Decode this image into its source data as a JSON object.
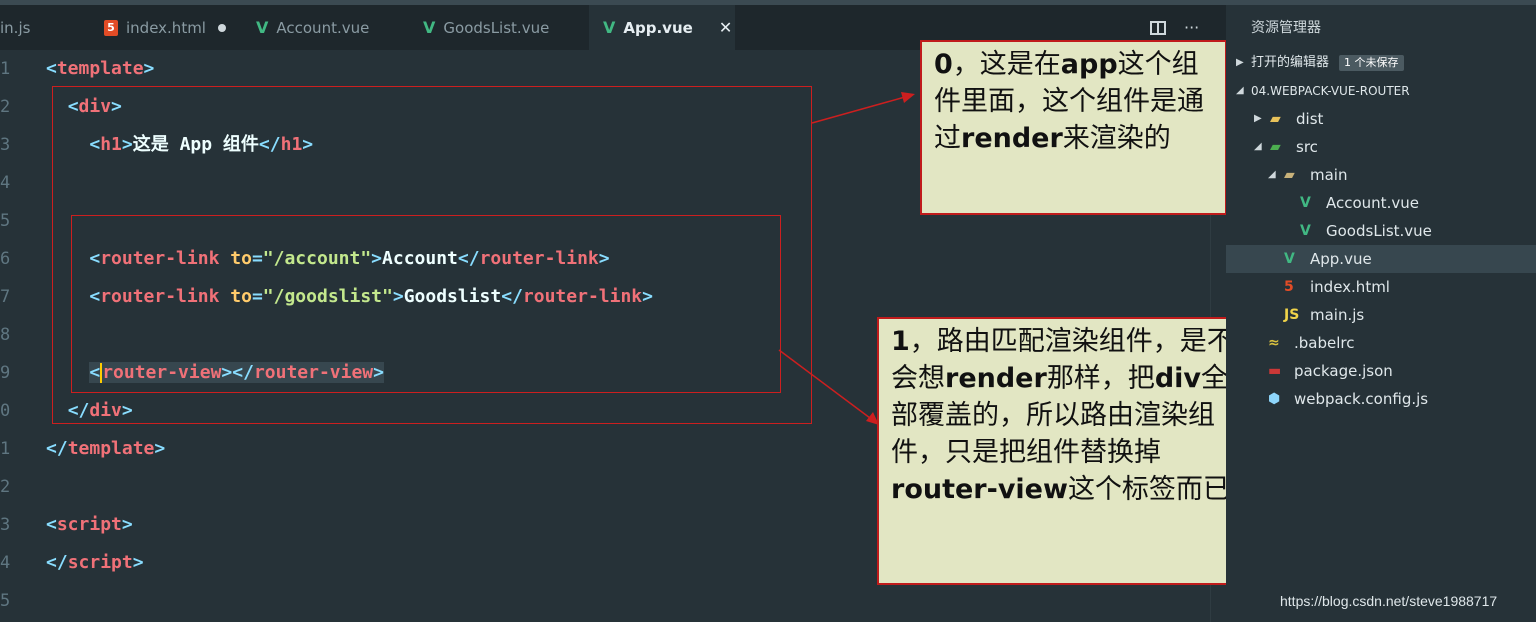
{
  "tabs": [
    {
      "label": "in.js",
      "type": "js"
    },
    {
      "label": "index.html",
      "type": "html",
      "modified": true
    },
    {
      "label": "Account.vue",
      "type": "vue"
    },
    {
      "label": "GoodsList.vue",
      "type": "vue"
    },
    {
      "label": "App.vue",
      "type": "vue",
      "active": true
    }
  ],
  "code_lines": [
    {
      "num": "1",
      "html": "<span class='pun'>&lt;</span><span class='tag'>template</span><span class='pun'>&gt;</span>"
    },
    {
      "num": "2",
      "html": "  <span class='pun'>&lt;</span><span class='tag'>div</span><span class='pun'>&gt;</span>"
    },
    {
      "num": "3",
      "html": "    <span class='pun'>&lt;</span><span class='tag'>h1</span><span class='pun'>&gt;</span><span class='txt'>这是 App 组件</span><span class='pun'>&lt;/</span><span class='tag'>h1</span><span class='pun'>&gt;</span>"
    },
    {
      "num": "4",
      "html": ""
    },
    {
      "num": "5",
      "html": ""
    },
    {
      "num": "6",
      "html": "    <span class='pun'>&lt;</span><span class='tag'>router-link</span> <span class='attr'>to</span><span class='pun'>=</span><span class='str'>\"/account\"</span><span class='pun'>&gt;</span><span class='txt'>Account</span><span class='pun'>&lt;/</span><span class='tag'>router-link</span><span class='pun'>&gt;</span>"
    },
    {
      "num": "7",
      "html": "    <span class='pun'>&lt;</span><span class='tag'>router-link</span> <span class='attr'>to</span><span class='pun'>=</span><span class='str'>\"/goodslist\"</span><span class='pun'>&gt;</span><span class='txt'>Goodslist</span><span class='pun'>&lt;/</span><span class='tag'>router-link</span><span class='pun'>&gt;</span>"
    },
    {
      "num": "8",
      "html": ""
    },
    {
      "num": "9",
      "html": "    <span class='sel-hl'><span class='pun'>&lt;</span><span class='cursor'></span><span class='tag'>router-view</span><span class='pun'>&gt;&lt;/</span><span class='tag'>router-view</span><span class='pun'>&gt;</span></span>"
    },
    {
      "num": "0",
      "html": "  <span class='pun'>&lt;/</span><span class='tag'>div</span><span class='pun'>&gt;</span>"
    },
    {
      "num": "1",
      "html": "<span class='pun'>&lt;/</span><span class='tag'>template</span><span class='pun'>&gt;</span>"
    },
    {
      "num": "2",
      "html": ""
    },
    {
      "num": "3",
      "html": "<span class='pun'>&lt;</span><span class='tag'>script</span><span class='pun'>&gt;</span>"
    },
    {
      "num": "4",
      "html": "<span class='pun'>&lt;/</span><span class='tag'>script</span><span class='pun'>&gt;</span>"
    },
    {
      "num": "5",
      "html": ""
    }
  ],
  "notes": {
    "note0": "<b>0</b>，这是在<b>app</b>这个组件里面，这个组件是通过<b>render</b>来渲染的",
    "note1": "<b>1</b>，路由匹配渲染组件，是不会想<b>render</b>那样，把<b>div</b>全部覆盖的，所以路由渲染组件，只是把组件替换掉<b>router-view</b>这个标签而已"
  },
  "sidebar": {
    "title": "资源管理器",
    "open_editors": "打开的编辑器",
    "unsaved_badge": "1 个未保存",
    "project": "04.WEBPACK-VUE-ROUTER",
    "files": [
      {
        "label": "dist",
        "kind": "folder-closed"
      },
      {
        "label": "src",
        "kind": "folder-open"
      },
      {
        "label": "main",
        "kind": "folder-open"
      },
      {
        "label": "Account.vue",
        "kind": "vue"
      },
      {
        "label": "GoodsList.vue",
        "kind": "vue"
      },
      {
        "label": "App.vue",
        "kind": "vue",
        "selected": true
      },
      {
        "label": "index.html",
        "kind": "html"
      },
      {
        "label": "main.js",
        "kind": "js"
      },
      {
        "label": ".babelrc",
        "kind": "babel"
      },
      {
        "label": "package.json",
        "kind": "npm"
      },
      {
        "label": "webpack.config.js",
        "kind": "webpack"
      }
    ]
  },
  "colors": {
    "accent": "#41b883",
    "annotation_border": "#c01b1b",
    "annotation_bg": "#e2e6c3"
  },
  "watermark": "https://blog.csdn.net/steve1988717"
}
